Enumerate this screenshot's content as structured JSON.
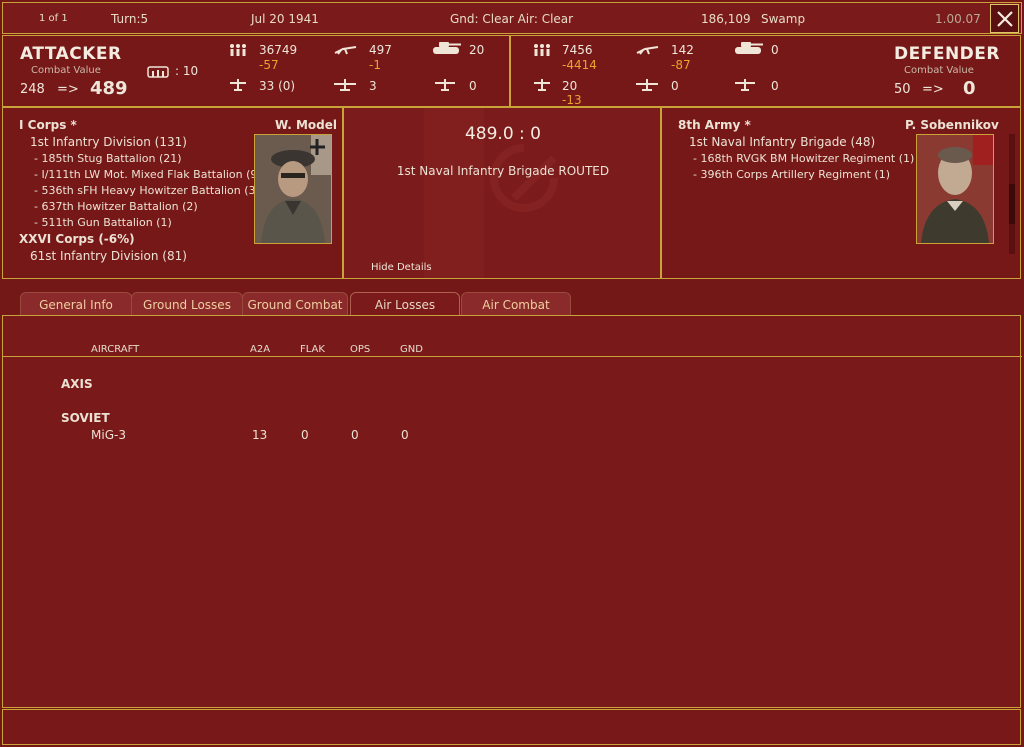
{
  "topbar": {
    "page": "1 of 1",
    "turn": "Turn:5",
    "date": "Jul 20 1941",
    "weather": "Gnd: Clear  Air: Clear",
    "location": "186,109",
    "terrain": "Swamp",
    "version": "1.00.07"
  },
  "attacker": {
    "title": "ATTACKER",
    "cv_label": "Combat Value",
    "cv_from": "248",
    "arrow": "=>",
    "cv_to": "489",
    "fort": ": 10",
    "men": "36749",
    "men_loss": "-57",
    "guns": "497",
    "guns_loss": "-1",
    "tanks": "20",
    "fighters": "33 (0)",
    "bombers": "3",
    "recon": "0"
  },
  "defender": {
    "title": "DEFENDER",
    "cv_label": "Combat Value",
    "cv_from": "50",
    "arrow": "=>",
    "cv_to": "0",
    "men": "7456",
    "men_loss": "-4414",
    "guns": "142",
    "guns_loss": "-87",
    "tanks": "0",
    "fighters": "20",
    "fighters_loss": "-13",
    "bombers": "0",
    "recon": "0"
  },
  "left_units": {
    "commander": "W. Model",
    "lines": [
      {
        "text": "I Corps *",
        "level": "hdr"
      },
      {
        "text": "1st Infantry Division (131)",
        "level": "l1"
      },
      {
        "text": "- 185th Stug Battalion (21)",
        "level": "l2"
      },
      {
        "text": "- I/111th LW Mot. Mixed Flak Battalion (9)",
        "level": "l2"
      },
      {
        "text": "- 536th sFH Heavy Howitzer Battalion (3)",
        "level": "l2"
      },
      {
        "text": "- 637th Howitzer Battalion (2)",
        "level": "l2"
      },
      {
        "text": "- 511th Gun Battalion (1)",
        "level": "l2"
      },
      {
        "text": "XXVI Corps (-6%)",
        "level": "hdr"
      },
      {
        "text": "61st Infantry Division (81)",
        "level": "l1"
      }
    ]
  },
  "center": {
    "ratio": "489.0 : 0",
    "result": "1st Naval Infantry Brigade ROUTED",
    "hide_details": "Hide Details"
  },
  "right_units": {
    "commander": "P. Sobennikov",
    "lines": [
      {
        "text": "8th Army *",
        "level": "hdr"
      },
      {
        "text": "1st Naval Infantry Brigade (48)",
        "level": "l1"
      },
      {
        "text": "- 168th RVGK BM Howitzer Regiment (1)",
        "level": "l2"
      },
      {
        "text": "- 396th Corps Artillery Regiment (1)",
        "level": "l2"
      }
    ]
  },
  "tabs": [
    {
      "label": "General Info",
      "active": false
    },
    {
      "label": "Ground Losses",
      "active": false
    },
    {
      "label": "Ground Combat",
      "active": false
    },
    {
      "label": "Air Losses",
      "active": true
    },
    {
      "label": "Air Combat",
      "active": false
    }
  ],
  "table": {
    "headers": {
      "aircraft": "AIRCRAFT",
      "a2a": "A2A",
      "flak": "FLAK",
      "ops": "OPS",
      "gnd": "GND"
    },
    "axis_label": "AXIS",
    "soviet_label": "SOVIET",
    "rows": [
      {
        "name": "MiG-3",
        "a2a": "13",
        "flak": "0",
        "ops": "0",
        "gnd": "0"
      }
    ]
  },
  "colors": {
    "accent": "#c9a23a",
    "background": "#741717",
    "loss": "#f0a030"
  }
}
